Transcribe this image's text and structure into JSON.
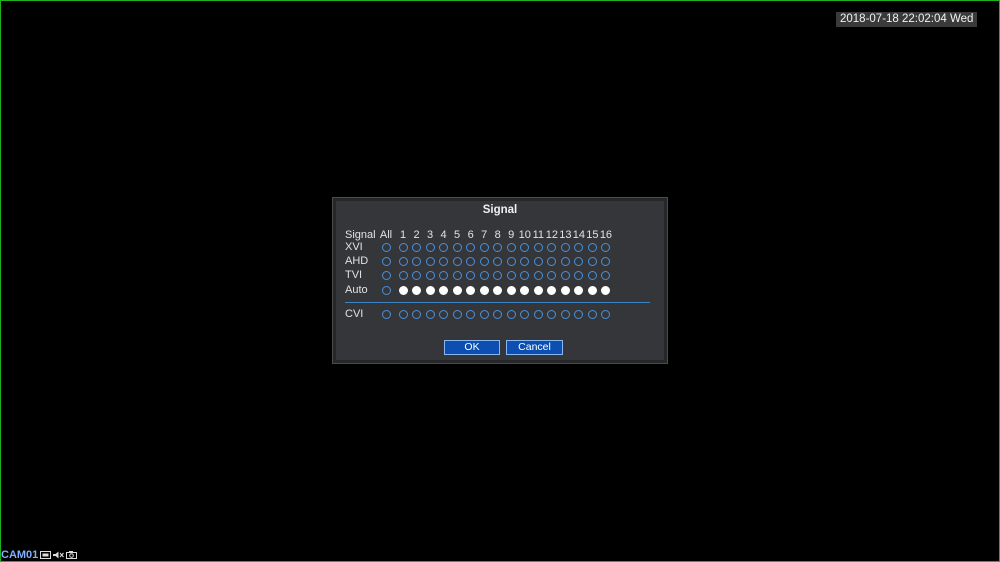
{
  "osd": {
    "datetime": "2018-07-18 22:02:04 Wed",
    "camera_label": "CAM01"
  },
  "dialog": {
    "title": "Signal",
    "header_label": "Signal",
    "all_label": "All",
    "channels": [
      "1",
      "2",
      "3",
      "4",
      "5",
      "6",
      "7",
      "8",
      "9",
      "10",
      "11",
      "12",
      "13",
      "14",
      "15",
      "16"
    ],
    "rows": [
      {
        "label": "XVI",
        "all_selected": false,
        "selected_channels": []
      },
      {
        "label": "AHD",
        "all_selected": false,
        "selected_channels": []
      },
      {
        "label": "TVI",
        "all_selected": false,
        "selected_channels": []
      },
      {
        "label": "Auto",
        "all_selected": false,
        "selected_channels": [
          "1",
          "2",
          "3",
          "4",
          "5",
          "6",
          "7",
          "8",
          "9",
          "10",
          "11",
          "12",
          "13",
          "14",
          "15",
          "16"
        ]
      },
      {
        "label": "CVI",
        "all_selected": false,
        "selected_channels": []
      }
    ],
    "ok_label": "OK",
    "cancel_label": "Cancel"
  },
  "colors": {
    "accent": "#4a90d9",
    "button": "#0c4fb1",
    "border_green": "#1db31d"
  },
  "icons": [
    "record-icon",
    "speaker-muted-icon",
    "camera-icon"
  ]
}
